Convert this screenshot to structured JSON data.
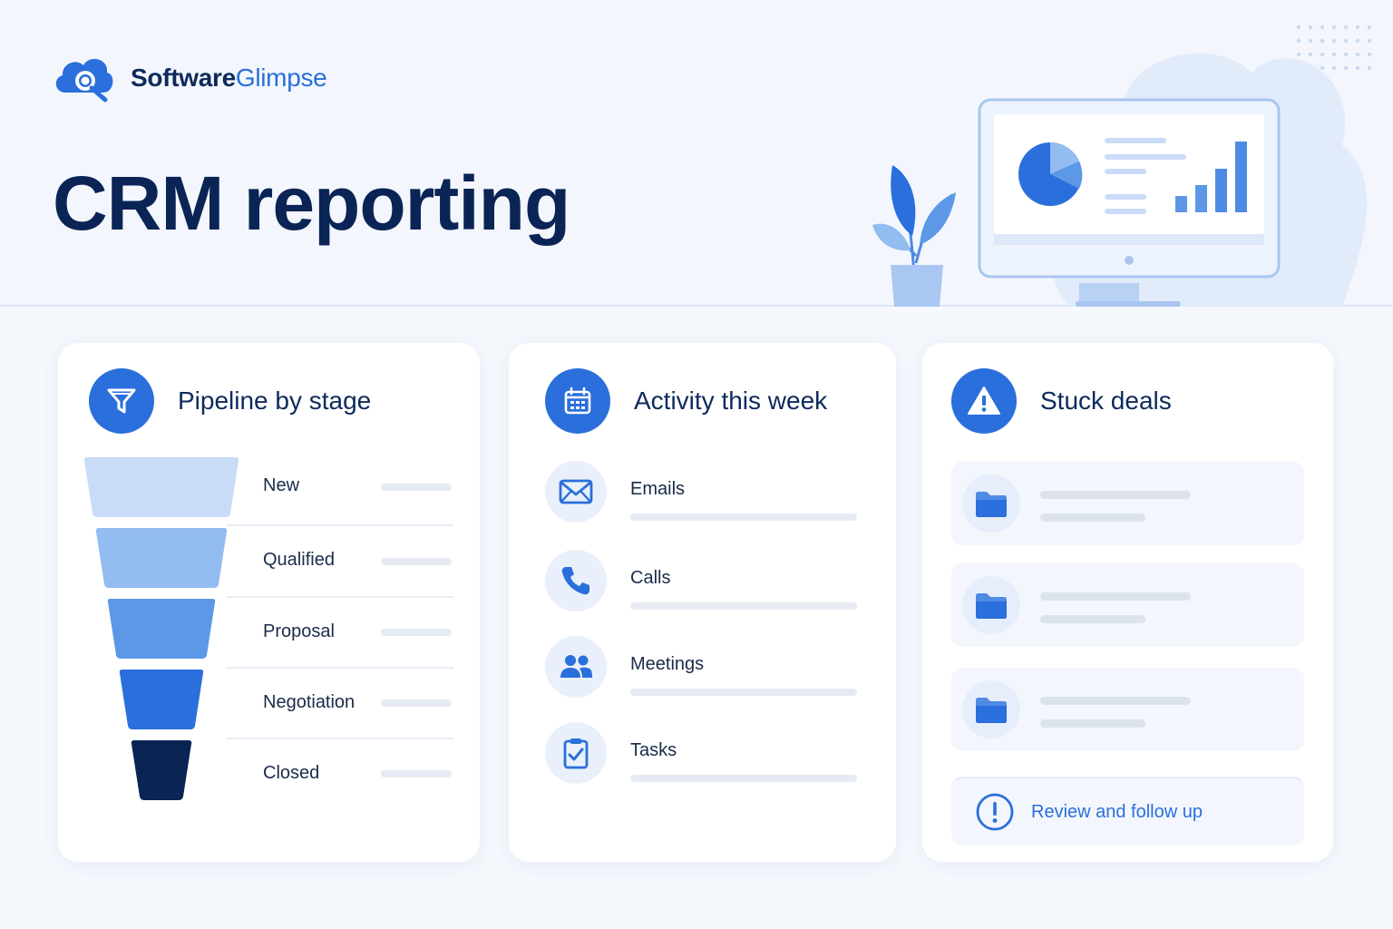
{
  "brand": {
    "name_part1": "Software",
    "name_part2": "Glimpse",
    "icon": "cloud-search-icon"
  },
  "page": {
    "title": "CRM reporting"
  },
  "colors": {
    "accent": "#2a6fdb",
    "navy": "#0b2456",
    "background": "#f5f8fd"
  },
  "pipeline": {
    "title": "Pipeline by stage",
    "icon": "funnel-icon",
    "stages": [
      {
        "label": "New",
        "color": "#c9dcf7"
      },
      {
        "label": "Qualified",
        "color": "#93bcf0"
      },
      {
        "label": "Proposal",
        "color": "#5c98e6"
      },
      {
        "label": "Negotiation",
        "color": "#2a6fdb"
      },
      {
        "label": "Closed",
        "color": "#0b2456"
      }
    ]
  },
  "activity": {
    "title": "Activity this week",
    "icon": "calendar-icon",
    "items": [
      {
        "label": "Emails",
        "icon": "envelope-icon"
      },
      {
        "label": "Calls",
        "icon": "phone-icon"
      },
      {
        "label": "Meetings",
        "icon": "people-icon"
      },
      {
        "label": "Tasks",
        "icon": "clipboard-check-icon"
      }
    ]
  },
  "stuck": {
    "title": "Stuck deals",
    "icon": "warning-icon",
    "deals": [
      {
        "icon": "folder-icon"
      },
      {
        "icon": "folder-icon"
      },
      {
        "icon": "folder-icon"
      }
    ],
    "action_label": "Review and follow up",
    "action_icon": "exclamation-circle-icon"
  }
}
